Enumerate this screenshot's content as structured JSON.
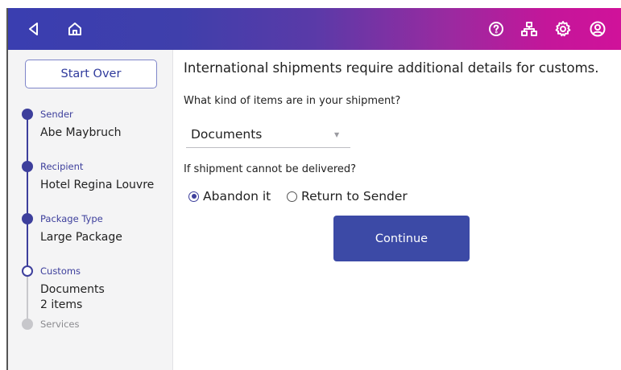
{
  "topbar": {
    "icons": [
      "back-icon",
      "home-icon",
      "help-icon",
      "network-icon",
      "settings-icon",
      "account-icon"
    ]
  },
  "sidebar": {
    "start_over_label": "Start Over",
    "steps": [
      {
        "label": "Sender",
        "value": "Abe Maybruch",
        "status": "done"
      },
      {
        "label": "Recipient",
        "value": "Hotel Regina Louvre",
        "status": "done"
      },
      {
        "label": "Package Type",
        "value": "Large Package",
        "status": "done"
      },
      {
        "label": "Customs",
        "value": "Documents",
        "value2": "2 items",
        "status": "current"
      },
      {
        "label": "Services",
        "status": "future"
      }
    ]
  },
  "main": {
    "heading": "International shipments require additional details for customs.",
    "items_question": "What kind of items are in your shipment?",
    "items_select_value": "Documents",
    "undeliverable_question": "If shipment cannot be delivered?",
    "options": [
      {
        "label": "Abandon it",
        "checked": true
      },
      {
        "label": "Return to Sender",
        "checked": false
      }
    ],
    "continue_label": "Continue"
  },
  "colors": {
    "accent": "#3d3f9c",
    "button": "#3c4aa6",
    "header_start": "#3a3eb0",
    "header_end": "#d0129a"
  }
}
